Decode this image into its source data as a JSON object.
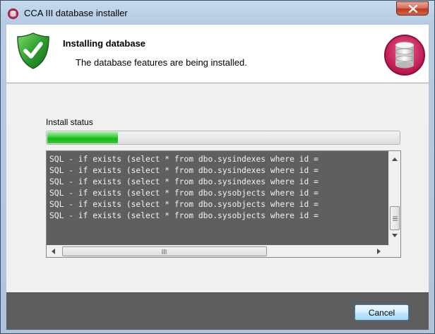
{
  "window": {
    "title": "CCA III database installer",
    "app_icon": "database-app-icon",
    "close_icon": "close-icon"
  },
  "header": {
    "title": "Installing database",
    "subtitle": "The database features are being installed.",
    "left_icon": "shield-check-icon",
    "right_icon": "database-icon"
  },
  "install": {
    "status_label": "Install status",
    "progress_fraction": 0.2,
    "progress_color": "#2ec42e"
  },
  "log": {
    "lines": [
      "SQL - if exists (select * from dbo.sysindexes where id =",
      "SQL - if exists (select * from dbo.sysindexes where id =",
      "SQL - if exists (select * from dbo.sysindexes where id =",
      "SQL - if exists (select * from dbo.sysobjects where id =",
      "SQL - if exists (select * from dbo.sysobjects where id =",
      "SQL - if exists (select * from dbo.sysobjects where id ="
    ],
    "background": "#5f5f5f"
  },
  "footer": {
    "cancel_label": "Cancel"
  }
}
